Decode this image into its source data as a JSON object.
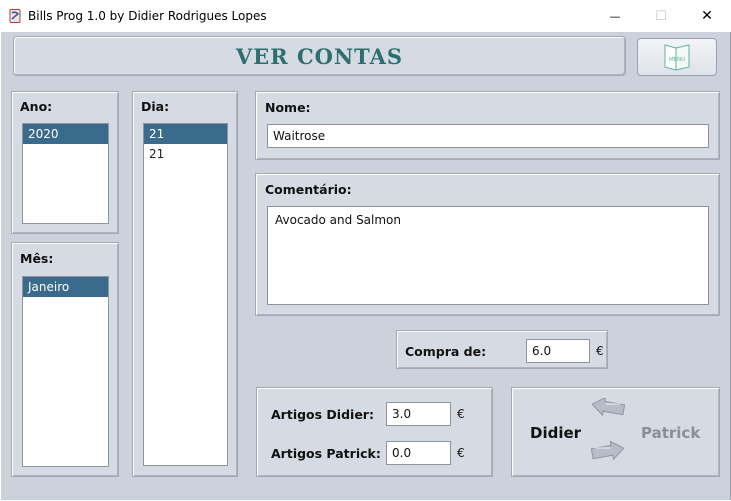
{
  "window": {
    "title": "Bills Prog 1.0 by Didier Rodrigues Lopes",
    "minimize_glyph": "—",
    "maximize_glyph": "☐",
    "close_glyph": "✕"
  },
  "header": {
    "title": "VER CONTAS",
    "menu_icon": "menu-book-icon",
    "menu_label": "MENU"
  },
  "ano": {
    "label": "Ano:",
    "items": [
      "2020"
    ],
    "selected": "2020"
  },
  "mes": {
    "label": "Mês:",
    "items": [
      "Janeiro"
    ],
    "selected": "Janeiro"
  },
  "dia": {
    "label": "Dia:",
    "items": [
      "21",
      "21"
    ],
    "selected_index": 0
  },
  "nome": {
    "label": "Nome:",
    "value": "Waitrose"
  },
  "comentario": {
    "label": "Comentário:",
    "value": "Avocado and Salmon"
  },
  "compra": {
    "label": "Compra de:",
    "value": "6.0",
    "currency": "€"
  },
  "artigos": {
    "didier_label": "Artigos Didier:",
    "didier_value": "3.0",
    "patrick_label": "Artigos Patrick:",
    "patrick_value": "0.0",
    "currency": "€"
  },
  "transfer": {
    "from": "Didier",
    "to": "Patrick",
    "arrow_icons": [
      "arrow-left-icon",
      "arrow-right-icon"
    ]
  },
  "colors": {
    "title_text": "#2d6e6e",
    "selection": "#3a6a8c",
    "background": "#cdd1dc",
    "disabled_name": "#8a8e96"
  }
}
